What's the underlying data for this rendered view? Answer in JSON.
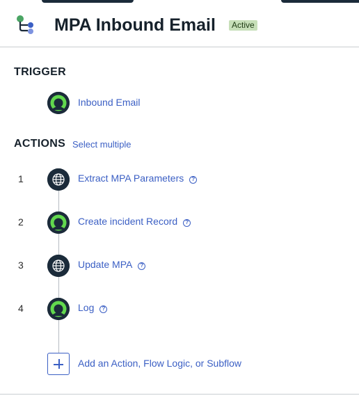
{
  "header": {
    "title": "MPA Inbound Email",
    "status_badge": "Active",
    "flow_icon": "flow-icon"
  },
  "trigger": {
    "section_label": "TRIGGER",
    "name": "Inbound Email",
    "icon": "record-icon"
  },
  "actions": {
    "section_label": "ACTIONS",
    "select_multiple": "Select multiple",
    "items": [
      {
        "number": "1",
        "label": "Extract MPA Parameters",
        "icon": "globe-icon"
      },
      {
        "number": "2",
        "label": "Create incident Record",
        "icon": "record-icon"
      },
      {
        "number": "3",
        "label": "Update MPA",
        "icon": "globe-icon"
      },
      {
        "number": "4",
        "label": "Log",
        "icon": "record-icon"
      }
    ],
    "add_label": "Add an Action, Flow Logic, or Subflow"
  },
  "colors": {
    "accent_link": "#3b5fc4",
    "node_dark": "#1b2b3a",
    "node_green": "#62d84e",
    "badge_bg": "#c7dfb9"
  }
}
